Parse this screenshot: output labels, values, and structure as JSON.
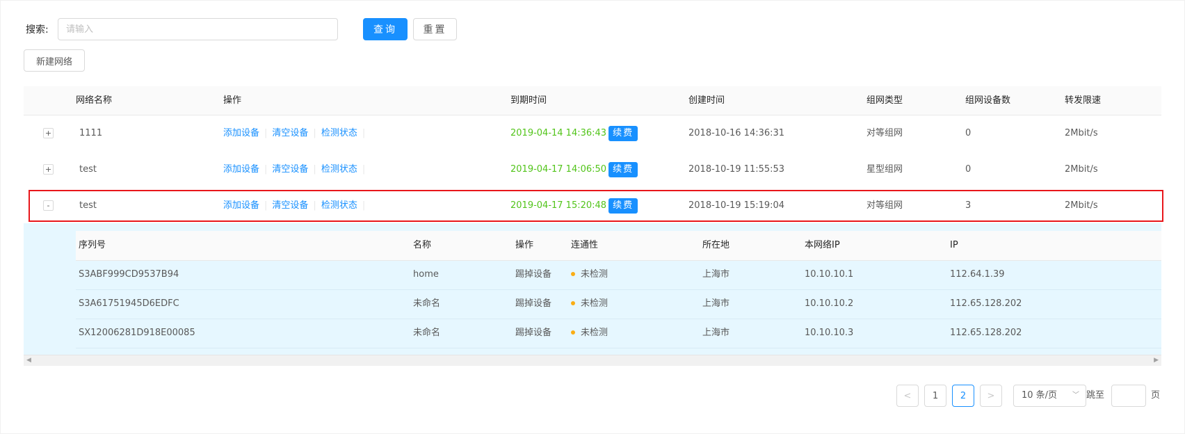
{
  "search": {
    "label": "搜索:",
    "placeholder": "请输入",
    "query_label": "查询",
    "reset_label": "重置"
  },
  "toolbar": {
    "new_network_label": "新建网络"
  },
  "table": {
    "columns": [
      "网络名称",
      "操作",
      "到期时间",
      "创建时间",
      "组网类型",
      "组网设备数",
      "转发限速"
    ],
    "actions": [
      "添加设备",
      "清空设备",
      "检测状态"
    ],
    "renew_label": "续费",
    "rows": [
      {
        "toggle": "+",
        "name": "1111",
        "expire": "2019-04-14 14:36:43",
        "created": "2018-10-16 14:36:31",
        "type": "对等组网",
        "device_count": "0",
        "rate": "2Mbit/s"
      },
      {
        "toggle": "+",
        "name": "test",
        "expire": "2019-04-17 14:06:50",
        "created": "2018-10-19 11:55:53",
        "type": "星型组网",
        "device_count": "0",
        "rate": "2Mbit/s"
      },
      {
        "toggle": "-",
        "name": "test",
        "expire": "2019-04-17 15:20:48",
        "created": "2018-10-19 15:19:04",
        "type": "对等组网",
        "device_count": "3",
        "rate": "2Mbit/s"
      }
    ]
  },
  "devices": {
    "columns": [
      "序列号",
      "名称",
      "操作",
      "连通性",
      "所在地",
      "本网络IP",
      "IP"
    ],
    "kick_label": "踢掉设备",
    "rows": [
      {
        "serial": "S3ABF999CD9537B94",
        "name": "home",
        "status": "未检测",
        "location": "上海市",
        "local_ip": "10.10.10.1",
        "ip": "112.64.1.39"
      },
      {
        "serial": "S3A61751945D6EDFC",
        "name": "未命名",
        "status": "未检测",
        "location": "上海市",
        "local_ip": "10.10.10.2",
        "ip": "112.65.128.202"
      },
      {
        "serial": "SX12006281D918E00085",
        "name": "未命名",
        "status": "未检测",
        "location": "上海市",
        "local_ip": "10.10.10.3",
        "ip": "112.65.128.202"
      }
    ]
  },
  "pagination": {
    "prev": "<",
    "next": ">",
    "pages": [
      "1",
      "2"
    ],
    "current_page": "2",
    "page_size": "10 条/页",
    "jump_label": "跳至",
    "page_unit": "页"
  },
  "colors": {
    "primary": "#1890ff",
    "expire_green": "#52c41a",
    "highlight_red": "#e8161b",
    "expanded_bg": "#e6f7ff",
    "status_dot": "#faad14"
  }
}
